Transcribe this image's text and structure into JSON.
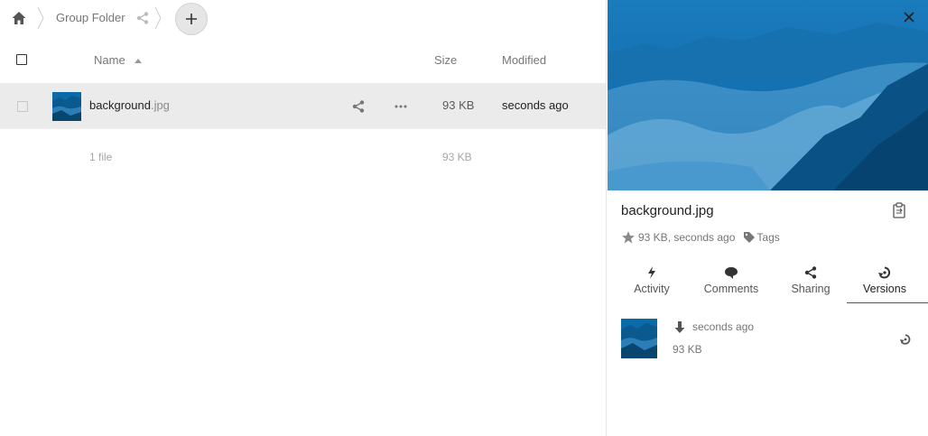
{
  "breadcrumb": {
    "home_icon": "home-icon",
    "folder": "Group Folder",
    "share_icon": "share-icon"
  },
  "toolbar": {
    "new_icon": "plus-icon"
  },
  "table": {
    "columns": [
      "Name",
      "Size",
      "Modified"
    ],
    "sort": "Name ascending",
    "rows": [
      {
        "name": "background",
        "ext": ".jpg",
        "size": "93 KB",
        "modified": "seconds ago",
        "selected": true
      }
    ],
    "summary": {
      "count": "1 file",
      "size": "93 KB"
    }
  },
  "sidebar": {
    "filename": "background.jpg",
    "meta": "93 KB, seconds ago",
    "tags_label": "Tags",
    "tabs": [
      {
        "label": "Activity",
        "icon": "lightning-icon"
      },
      {
        "label": "Comments",
        "icon": "comment-icon"
      },
      {
        "label": "Sharing",
        "icon": "share-icon"
      },
      {
        "label": "Versions",
        "icon": "history-icon",
        "active": true
      }
    ],
    "versions": [
      {
        "time": "seconds ago",
        "size": "93 KB"
      }
    ]
  },
  "colors": {
    "preview_blue": "#0a6aa6",
    "selected_row": "#ebebeb",
    "muted_text": "#767676"
  }
}
